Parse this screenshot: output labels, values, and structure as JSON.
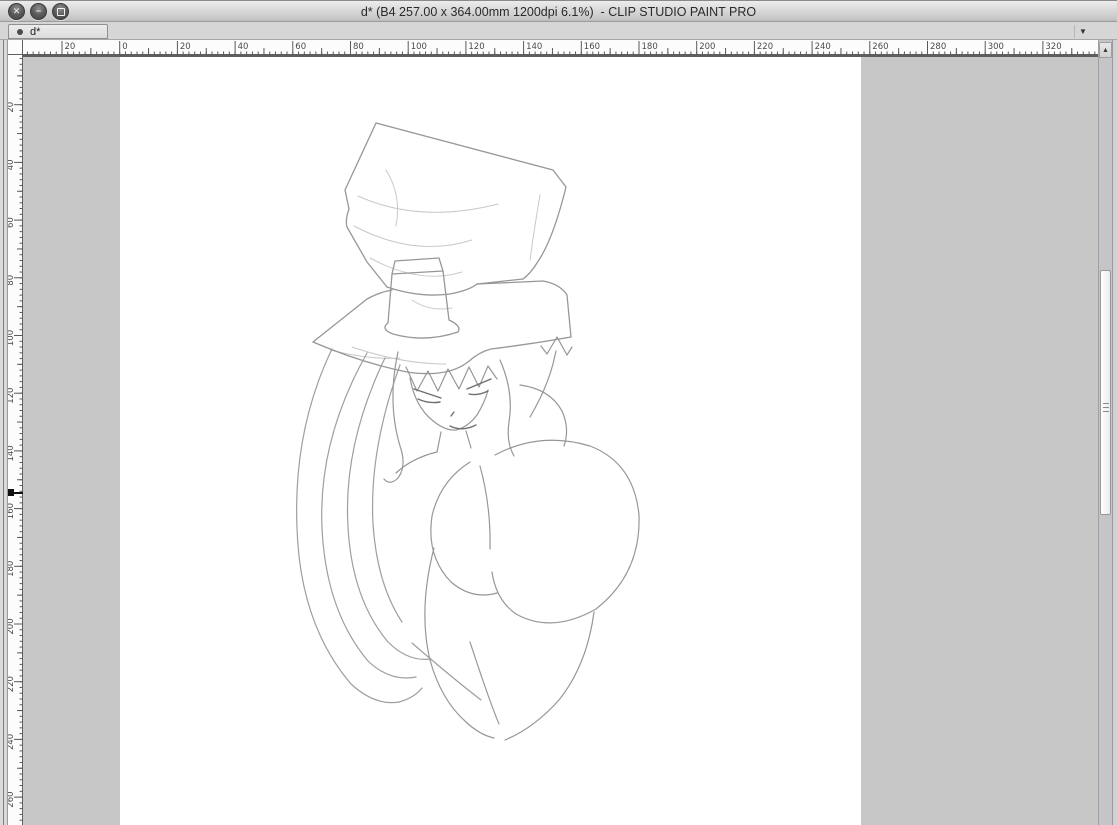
{
  "window": {
    "title": "d* (B4 257.00 x 364.00mm 1200dpi 6.1%)  - CLIP STUDIO PAINT PRO",
    "controls": {
      "close_glyph": "✕",
      "minimize_glyph": "−",
      "maximize_glyph": "▢"
    }
  },
  "tab_bar": {
    "active_tab": {
      "indicator": "●",
      "label": "d*"
    },
    "overflow_glyph": "▼"
  },
  "rulers": {
    "unit": "mm",
    "horizontal_labels": [
      "20",
      "0",
      "20",
      "40",
      "60",
      "80",
      "100",
      "120",
      "140",
      "160",
      "180",
      "200",
      "220",
      "240",
      "260",
      "280",
      "300",
      "320"
    ],
    "vertical_labels": [
      "20",
      "40",
      "60",
      "80",
      "100",
      "120",
      "140",
      "160",
      "180",
      "200",
      "220",
      "240",
      "260"
    ]
  },
  "scrollbar": {
    "up_glyph": "▲"
  },
  "canvas": {
    "document_format": "B4 257.00 x 364.00mm 1200dpi",
    "zoom_level": "6.1%",
    "artwork_description": "Light gray pencil line-art sketch on white paper: a character wearing a tall crumpled top hat with a wide brim and small hat band cylinder, intense eyes, long hair sweeping down to the left, bare shoulders and torso tapering to the hips, and a small barbed arrow (tail tip) at the upper right"
  },
  "colors": {
    "pasteboard": "#c7c7c7",
    "paper": "#ffffff",
    "chrome": "#d6d6d6",
    "ruler_bg": "#fcfcfc",
    "ruler_ink": "#4a4a4a",
    "sketch_line": "#979797",
    "marker": "#111111"
  }
}
